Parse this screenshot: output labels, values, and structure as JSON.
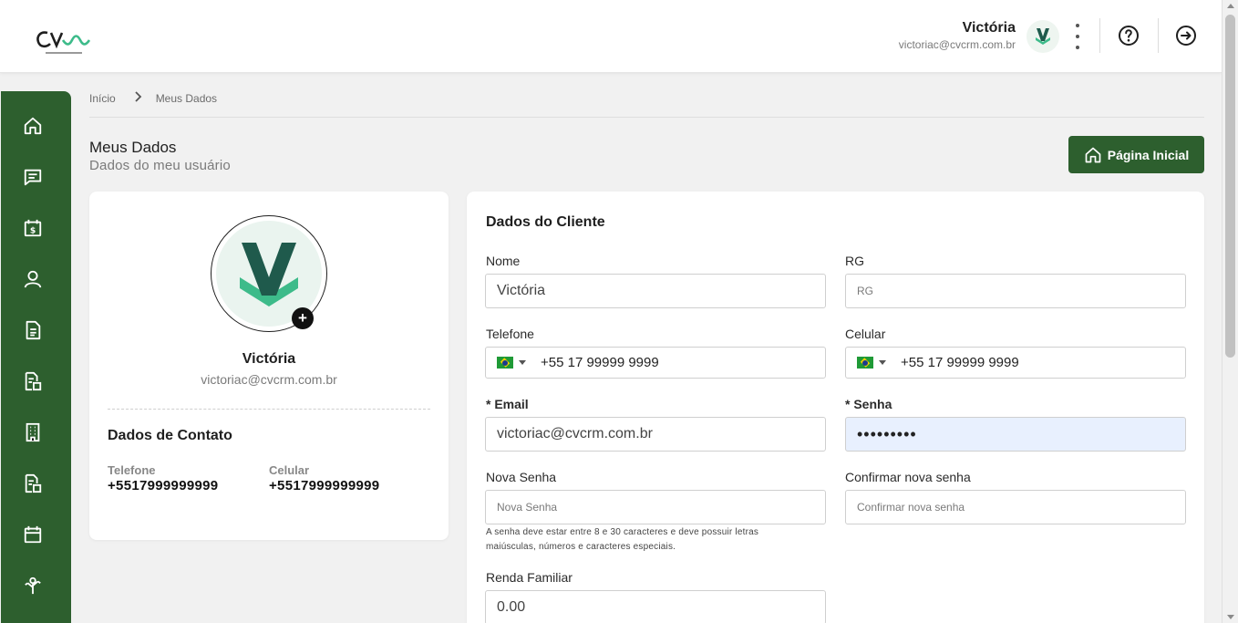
{
  "header": {
    "logo_alt": "CV",
    "user_name": "Victória",
    "user_email": "victoriac@cvcrm.com.br",
    "icons": [
      "more-vertical-icon",
      "help-icon",
      "logout-icon"
    ]
  },
  "sidebar": {
    "items": [
      {
        "icon": "home-icon"
      },
      {
        "icon": "chat-icon"
      },
      {
        "icon": "finance-calendar-icon"
      },
      {
        "icon": "user-icon"
      },
      {
        "icon": "document-icon"
      },
      {
        "icon": "document-search-icon"
      },
      {
        "icon": "building-icon"
      },
      {
        "icon": "document-search-icon"
      },
      {
        "icon": "calendar-icon"
      },
      {
        "icon": "plant-icon"
      }
    ],
    "color": "#2d5f2e"
  },
  "breadcrumb": {
    "items": [
      "Início",
      "Meus Dados"
    ]
  },
  "page": {
    "title": "Meus Dados",
    "subtitle": "Dados do meu usuário",
    "home_button_label": "Página Inicial"
  },
  "profile": {
    "name": "Victória",
    "email": "victoriac@cvcrm.com.br",
    "contact_title": "Dados de Contato",
    "phone_label": "Telefone",
    "phone_value": "+5517999999999",
    "cell_label": "Celular",
    "cell_value": "+5517999999999"
  },
  "form": {
    "section_title": "Dados do Cliente",
    "nome_label": "Nome",
    "nome_value": "Victória",
    "rg_label": "RG",
    "rg_placeholder": "RG",
    "telefone_label": "Telefone",
    "telefone_value": "+55 17 99999 9999",
    "celular_label": "Celular",
    "celular_value": "+55 17 99999 9999",
    "email_label": "* Email",
    "email_value": "victoriac@cvcrm.com.br",
    "senha_label": "* Senha",
    "senha_value": "•••••••••",
    "nova_senha_label": "Nova Senha",
    "nova_senha_placeholder": "Nova Senha",
    "confirmar_label": "Confirmar nova senha",
    "confirmar_placeholder": "Confirmar nova senha",
    "password_hint": "A senha deve estar entre 8 e 30 caracteres e deve possuir letras maiúsculas, números e caracteres especiais.",
    "renda_label": "Renda Familiar",
    "renda_value": "0.00"
  },
  "colors": {
    "brand_green": "#2d5f2e",
    "accent_teal": "#3dbb8a",
    "dark_teal": "#1f5a4c"
  }
}
